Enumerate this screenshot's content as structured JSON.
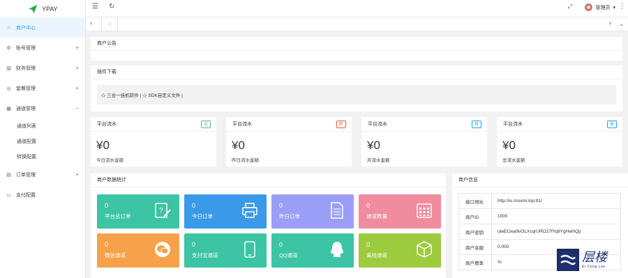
{
  "brand": {
    "name": "YPAY"
  },
  "sidebar": {
    "items": [
      {
        "label": "商户中心",
        "icon": "home-icon",
        "active": true
      },
      {
        "label": "账号管理",
        "icon": "gear-icon",
        "expand": "+"
      },
      {
        "label": "财务管理",
        "icon": "chart-icon",
        "expand": "+"
      },
      {
        "label": "套餐管理",
        "icon": "target-icon",
        "expand": "+"
      },
      {
        "label": "通道管理",
        "icon": "grid-icon",
        "expand": "−"
      },
      {
        "label": "订单管理",
        "icon": "tag-icon",
        "expand": "+"
      },
      {
        "label": "支付配置",
        "icon": "money-icon"
      }
    ],
    "channel_sub": [
      "通道列表",
      "通道配置",
      "转换配置"
    ]
  },
  "header": {
    "user": "管理员"
  },
  "announcement": {
    "title": "商户公告"
  },
  "plugin": {
    "title": "插件下载",
    "links": "☆ 三合一挂机软件 | ☆ SDK自定义文件 |"
  },
  "stats": [
    {
      "title": "平台流水",
      "badge": "日",
      "badge_color": "#5fb878",
      "value": "¥0",
      "caption": "今日流水金额"
    },
    {
      "title": "平台流水",
      "badge": "昨",
      "badge_color": "#ff5722",
      "value": "¥0",
      "caption": "昨日流水金额"
    },
    {
      "title": "平台流水",
      "badge": "月",
      "badge_color": "#1e9fff",
      "value": "¥0",
      "caption": "月流水金额"
    },
    {
      "title": "平台流水",
      "badge": "总",
      "badge_color": "#1e9fff",
      "value": "¥0",
      "caption": "总流水金额"
    }
  ],
  "merchant_stats": {
    "title": "商户数据统计",
    "tiles": [
      {
        "num": "0",
        "label": "平台总订单",
        "color": "#3cc4a4",
        "icon": "document-edit-icon"
      },
      {
        "num": "0",
        "label": "今日订单",
        "color": "#3a9ae8",
        "icon": "printer-icon"
      },
      {
        "num": "0",
        "label": "昨日订单",
        "color": "#9b9ef7",
        "icon": "file-list-icon"
      },
      {
        "num": "0",
        "label": "通道数量",
        "color": "#f08c9e",
        "icon": "calendar-grid-icon"
      },
      {
        "num": "0",
        "label": "微信通道",
        "color": "#f7a24a",
        "icon": "wechat-icon"
      },
      {
        "num": "0",
        "label": "支付宝通道",
        "color": "#3cc4a4",
        "icon": "tablet-icon"
      },
      {
        "num": "0",
        "label": "QQ通道",
        "color": "#3cc4a4",
        "icon": "qq-penguin-icon"
      },
      {
        "num": "0",
        "label": "离线通道",
        "color": "#9ccb3e",
        "icon": "cube-icon"
      }
    ]
  },
  "merchant_info": {
    "title": "商户信息",
    "rows": [
      {
        "key": "接口地址",
        "value": "http://iu.moxmi.top:81/"
      },
      {
        "key": "商户ID",
        "value": "1000"
      },
      {
        "key": "商户密钥",
        "value": "uteECwa9vOLXcqrURO27fYq9YgHelhQp"
      },
      {
        "key": "商户余额",
        "value": "0.000"
      },
      {
        "key": "商户费率",
        "value": "%"
      }
    ]
  },
  "watermark": {
    "cn": "层楼",
    "en": "Er Ceng Lou"
  }
}
